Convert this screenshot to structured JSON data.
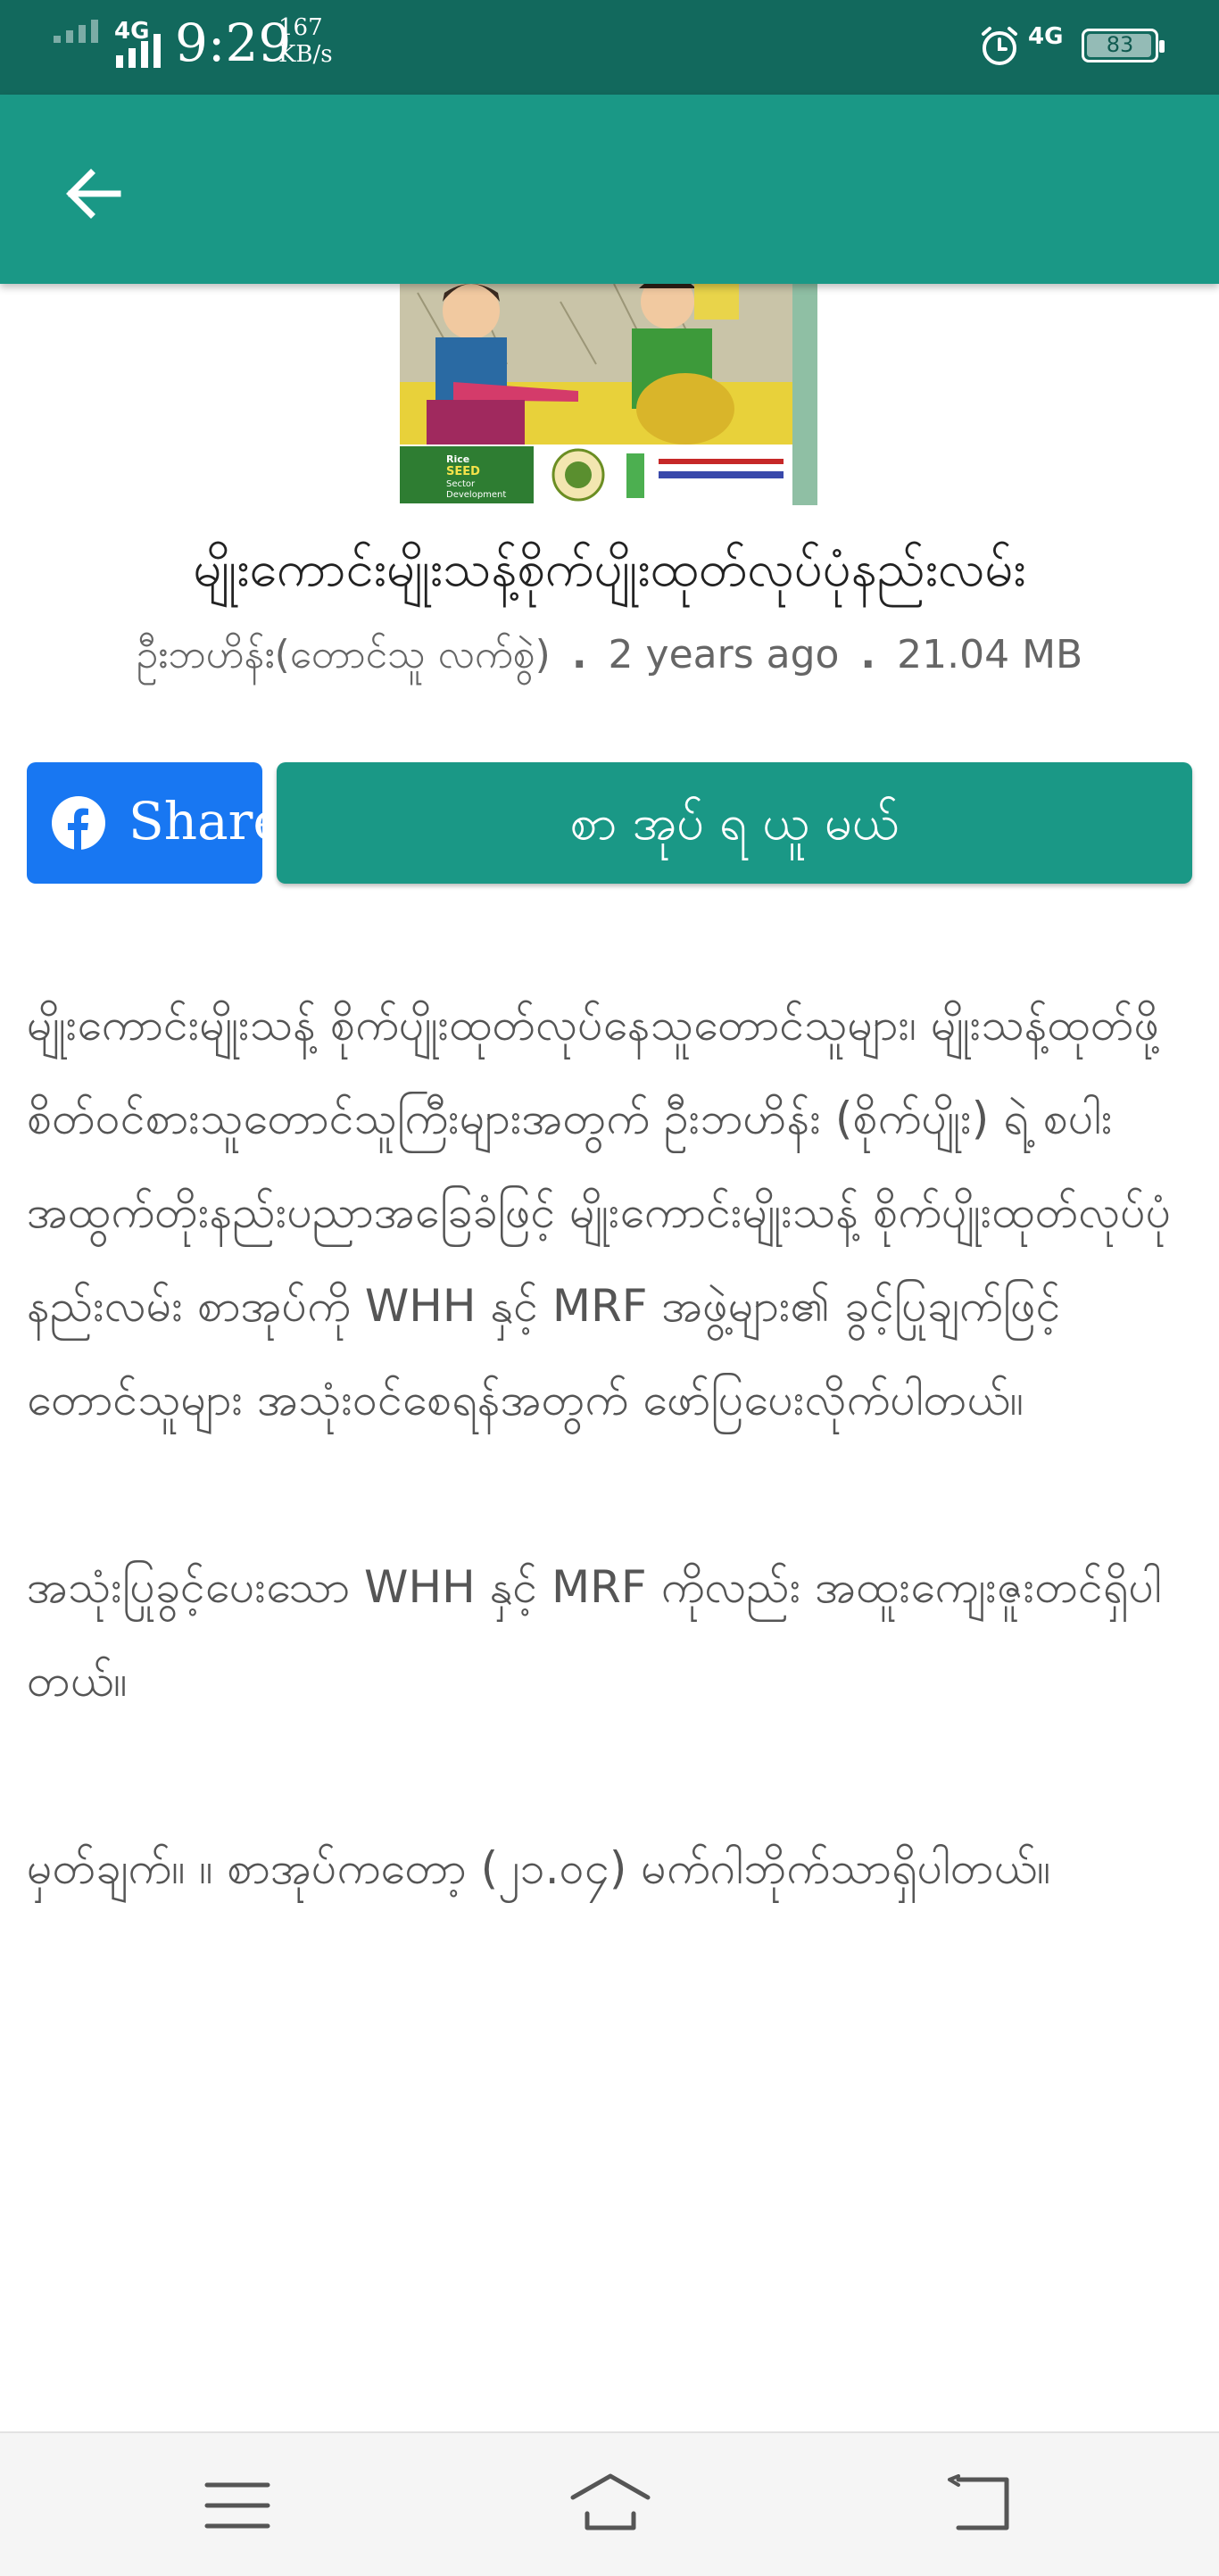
{
  "status_bar": {
    "network_left": "4G",
    "time": "9:29",
    "speed_value": "167",
    "speed_unit": "KB/s",
    "network_right": "4G",
    "battery": "83"
  },
  "app_bar": {
    "back_icon": "arrow-left-icon"
  },
  "book": {
    "cover_logo_lines": [
      "Rice",
      "SEED",
      "Sector",
      "Development"
    ],
    "title": "မျိုးကောင်းမျိုးသန့်စိုက်ပျိုးထုတ်လုပ်ပုံနည်းလမ်း",
    "author": "ဦးဘဟိန်း(တောင်သူ လက်စွဲ)",
    "age": "2 years ago",
    "size": "21.04 MB"
  },
  "actions": {
    "share_label": "Share",
    "read_label": "စာ အုပ် ရ ယူ မယ်"
  },
  "description": "မျိုးကောင်းမျိုးသန့် စိုက်ပျိုးထုတ်လုပ်နေသူတောင်သူများ၊ မျိုးသန့်ထုတ်ဖို့ စိတ်ဝင်စားသူတောင်သူကြီးများအတွက် ဦးဘဟိန်း (စိုက်ပျိုး) ရဲ့ စပါးအထွက်တိုးနည်းပညာအခြေခံဖြင့် မျိုးကောင်းမျိုးသန့် စိုက်ပျိုးထုတ်လုပ်ပုံနည်းလမ်း စာအုပ်ကို WHH နှင့် MRF အဖွဲ့များ၏ ခွင့်ပြုချက်ဖြင့် တောင်သူများ အသုံးဝင်စေရန်အတွက် ဖော်ပြပေးလိုက်ပါတယ်။\n\nအသုံးပြုခွင့်ပေးသော WHH နှင့် MRF ကိုလည်း အထူးကျေးဇူးတင်ရှိပါတယ်။\n\nမှတ်ချက်။ ။ စာအုပ်ကတော့ (၂၁.၀၄) မက်ဂါဘိုက်သာရှိပါတယ်။",
  "bottom_nav": {
    "menu_icon": "menu-icon",
    "home_icon": "home-icon",
    "back_icon": "back-icon"
  },
  "colors": {
    "status_bar": "#12695d",
    "app_bar": "#1a9886",
    "facebook": "#1877f2",
    "primary_button": "#1a9886"
  }
}
